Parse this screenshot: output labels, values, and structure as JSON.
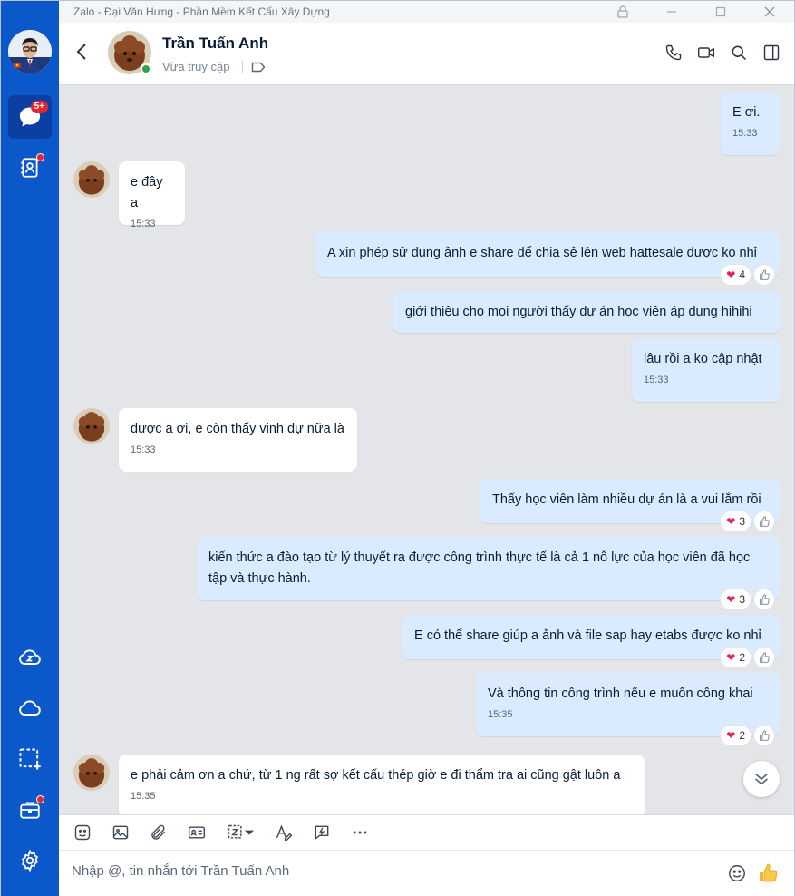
{
  "window": {
    "title": "Zalo - Đại Văn Hưng - Phần Mềm Kết Cấu Xây Dựng"
  },
  "sidebar": {
    "chat_badge": "5+"
  },
  "header": {
    "name": "Trần Tuấn Anh",
    "status": "Vừa truy cập"
  },
  "messages": [
    {
      "dir": "out",
      "text": "E ơi.",
      "time": "15:33"
    },
    {
      "dir": "in",
      "text": "e đây a",
      "time": "15:33"
    },
    {
      "dir": "out",
      "text": "A xin phép sử dụng ảnh e share để chia sẻ lên web hattesale được ko nhỉ",
      "time": "",
      "reactions": "4"
    },
    {
      "dir": "out",
      "text": "giới thiệu cho mọi người thấy dự án học viên áp dụng hihihi",
      "time": ""
    },
    {
      "dir": "out",
      "text": "lâu rồi a ko cập nhật",
      "time": "15:33"
    },
    {
      "dir": "in",
      "text": "được a ơi, e còn thấy vinh dự nữa là",
      "time": "15:33"
    },
    {
      "dir": "out",
      "text": "Thấy học viên làm nhiều dự án là a vui lắm rồi",
      "time": "",
      "reactions": "3"
    },
    {
      "dir": "out",
      "text": "kiến thức a đào tạo từ lý thuyết ra được công trình thực tế là cả 1 nỗ lực của học viên đã học tập và thực hành.",
      "time": "",
      "reactions": "3"
    },
    {
      "dir": "out",
      "text": "E có thể share giúp a ảnh và file sap hay etabs được ko nhỉ",
      "time": "",
      "reactions": "2"
    },
    {
      "dir": "out",
      "text": "Và thông tin công trình nếu e muốn công khai",
      "time": "15:35",
      "reactions": "2"
    },
    {
      "dir": "in",
      "text": "e phải cảm ơn a chứ, từ 1 ng rất sợ kết cấu thép giờ e đi thẩm tra ai cũng gật luôn a",
      "time": "15:35"
    }
  ],
  "input": {
    "placeholder": "Nhập @, tin nhắn tới Trần Tuấn Anh"
  },
  "colors": {
    "sidebar": "#0a58ca",
    "outgoing_bubble": "#dbebff",
    "incoming_bubble": "#ffffff",
    "chat_bg": "#e3e5e8"
  }
}
